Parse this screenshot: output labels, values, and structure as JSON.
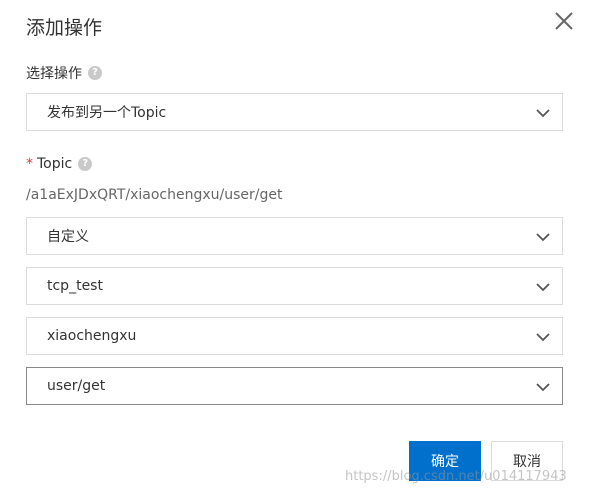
{
  "dialog": {
    "title": "添加操作",
    "close_icon": "close-icon"
  },
  "operation": {
    "label": "选择操作",
    "help_icon": "question-circle-icon",
    "selected": "发布到另一个Topic"
  },
  "topic": {
    "required_mark": "*",
    "label": "Topic",
    "help_icon": "question-circle-icon",
    "path": "/a1aExJDxQRT/xiaochengxu/user/get",
    "selects": [
      {
        "value": "自定义"
      },
      {
        "value": "tcp_test"
      },
      {
        "value": "xiaochengxu"
      },
      {
        "value": "user/get"
      }
    ]
  },
  "footer": {
    "confirm_label": "确定",
    "cancel_label": "取消"
  },
  "watermark": "https://blog.csdn.net/u014117943",
  "colors": {
    "primary": "#0070cc",
    "required": "#e4393c",
    "border": "#dcdcdc"
  }
}
